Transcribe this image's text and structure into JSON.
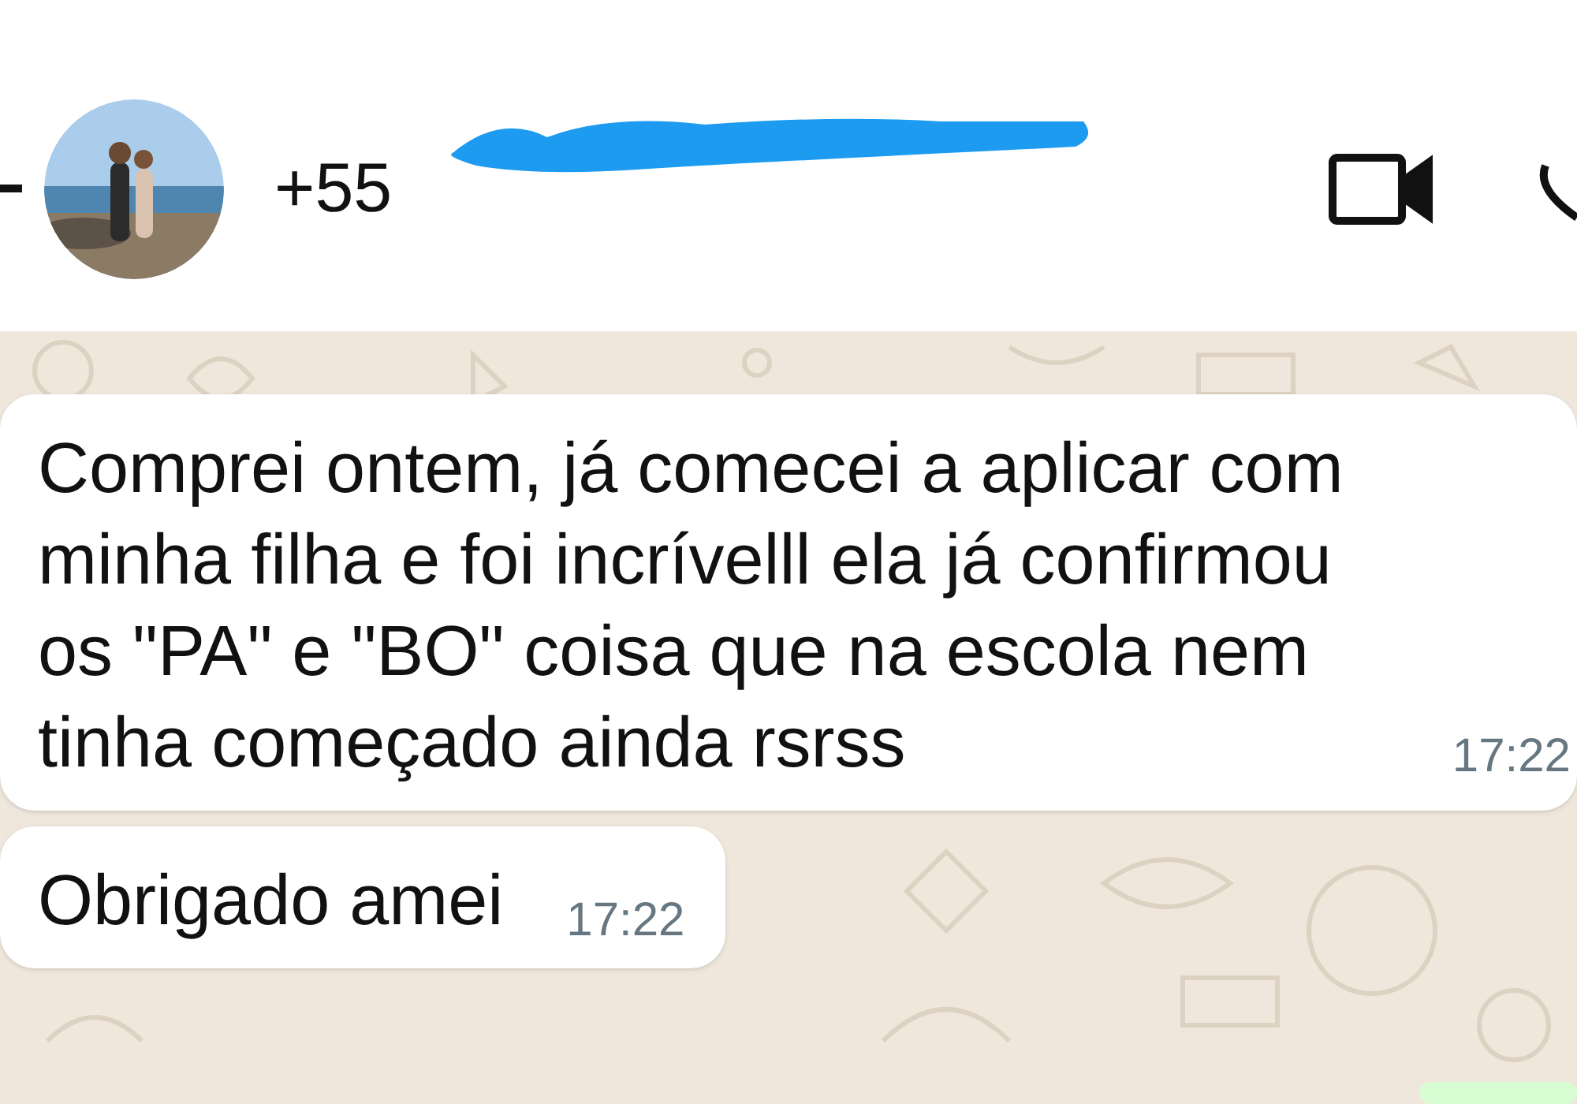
{
  "header": {
    "contact_name": "+55"
  },
  "messages": [
    {
      "text": "Comprei ontem, já comecei a aplicar com minha filha e foi incrívelll ela já confirmou os \"PA\" e \"BO\" coisa que na escola nem tinha começado ainda rsrss",
      "time": "17:22"
    },
    {
      "text": "Obrigado amei",
      "time": "17:22"
    }
  ]
}
